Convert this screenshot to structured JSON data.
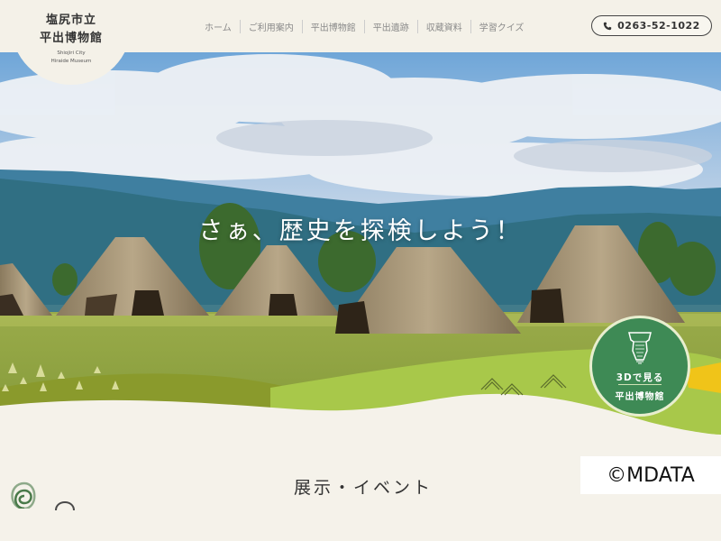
{
  "logo": {
    "line1": "塩尻市立",
    "line2": "平出博物館",
    "en_line1": "Shiojiri City",
    "en_line2": "Hiraide Museum"
  },
  "nav": {
    "items": [
      "ホーム",
      "ご利用案内",
      "平出博物館",
      "平出遺跡",
      "収蔵資料",
      "学習クイズ"
    ]
  },
  "contact": {
    "phone": "0263-52-1022",
    "icon": "phone-icon"
  },
  "hero": {
    "tagline": "さぁ、歴史を探検しよう！"
  },
  "badge": {
    "line1": "3Dで見る",
    "line2": "平出博物館",
    "icon": "vessel-icon"
  },
  "section": {
    "title": "展示・イベント"
  },
  "copyright": "©MDATA",
  "colors": {
    "accent_green": "#3e8a55",
    "light_green": "#a8c84a",
    "olive": "#8a9a2c",
    "background": "#f5f2ea"
  }
}
